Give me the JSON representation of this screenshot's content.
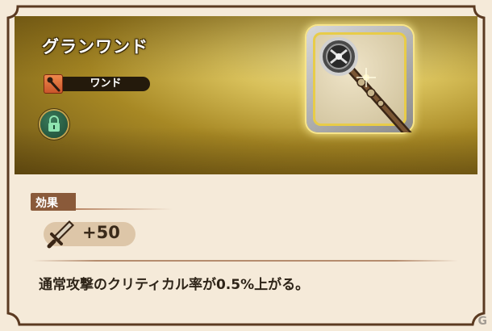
{
  "item": {
    "name": "グランワンド",
    "type_label": "ワンド",
    "locked": true
  },
  "effect": {
    "section_label": "効果",
    "stat_value": "+50",
    "description": "通常攻撃のクリティカル率が0.5%上がる。"
  },
  "watermark": "G",
  "icons": {
    "type": "wand-icon",
    "lock": "lock-icon",
    "stat": "sword-attack-icon",
    "weapon": "wand-weapon-image"
  },
  "colors": {
    "panel_bg": "#f5ead9",
    "frame_border": "#5b3a21",
    "hero_gold": "#a78824",
    "type_pill": "#241a0c",
    "section_tag": "#8a5a3a",
    "stat_pill": "#ddc6a8",
    "text_dark": "#2e2418"
  }
}
